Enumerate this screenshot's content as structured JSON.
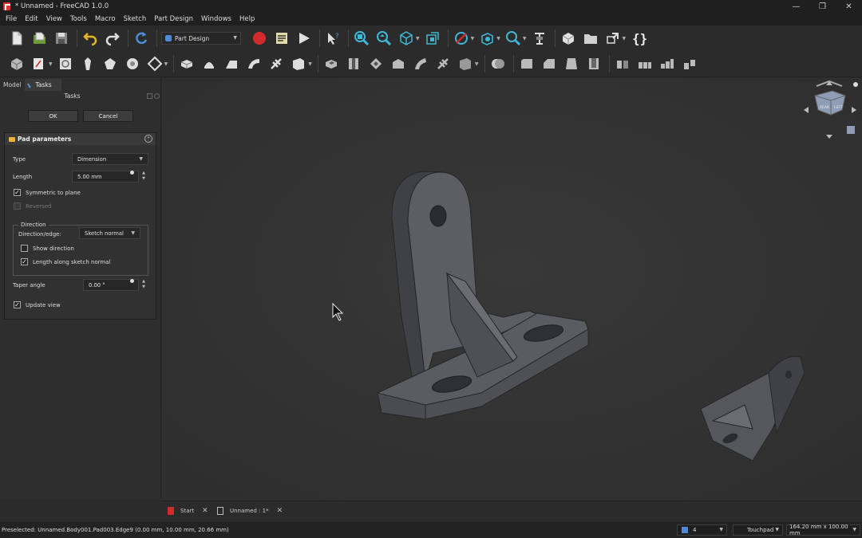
{
  "window": {
    "title": "* Unnamed - FreeCAD 1.0.0",
    "minimize": "—",
    "maximize": "❐",
    "close": "✕"
  },
  "menu": [
    "File",
    "Edit",
    "View",
    "Tools",
    "Macro",
    "Sketch",
    "Part Design",
    "Windows",
    "Help"
  ],
  "toolbar": {
    "workbench": "Part Design",
    "icons_row1": [
      "new-file-icon",
      "open-file-icon",
      "save-icon",
      "undo-icon",
      "redo-icon",
      "refresh-icon",
      "macro-record-icon",
      "macro-edit-icon",
      "macro-run-icon",
      "whats-this-icon",
      "fit-all-icon",
      "fit-selection-icon",
      "standard-views-icon",
      "sketch-view-icon",
      "draw-style-icon",
      "bounding-box-icon",
      "zoom-icon",
      "measure-icon",
      "part-icon",
      "group-icon",
      "link-icon",
      "python-braces-icon"
    ],
    "icons_row2": [
      "body-icon",
      "sketch-icon",
      "validate-sketch-icon",
      "clone-icon",
      "shape-binder-icon",
      "sub-shape-binder-icon",
      "datum-plane-icon",
      "pad-icon",
      "revolution-icon",
      "additive-loft-icon",
      "additive-pipe-icon",
      "additive-helix-icon",
      "additive-primitive-icon",
      "pocket-icon",
      "hole-icon",
      "groove-icon",
      "subtractive-loft-icon",
      "subtractive-pipe-icon",
      "subtractive-helix-icon",
      "subtractive-primitive-icon",
      "boolean-icon",
      "fillet-icon",
      "chamfer-icon",
      "draft-icon",
      "thickness-icon",
      "mirrored-icon",
      "linear-pattern-icon",
      "polar-pattern-icon",
      "multi-transform-icon"
    ]
  },
  "panel": {
    "tabs": [
      "Model",
      "Tasks"
    ],
    "title": "Tasks",
    "ok_label": "OK",
    "cancel_label": "Cancel",
    "pad": {
      "header": "Pad parameters",
      "type_label": "Type",
      "type_value": "Dimension",
      "length_label": "Length",
      "length_value": "5.00 mm",
      "symmetric_label": "Symmetric to plane",
      "symmetric_checked": true,
      "reversed_label": "Reversed",
      "reversed_checked": false,
      "direction_title": "Direction",
      "direction_edge_label": "Direction/edge:",
      "direction_edge_value": "Sketch normal",
      "show_direction_label": "Show direction",
      "show_direction_checked": false,
      "length_along_label": "Length along sketch normal",
      "length_along_checked": true,
      "taper_label": "Taper angle",
      "taper_value": "0.00 °",
      "update_view_label": "Update view",
      "update_view_checked": true
    }
  },
  "navcube": {
    "faces": [
      "REAR",
      "LEFT"
    ]
  },
  "doc_tabs": [
    {
      "label": "Start"
    },
    {
      "label": "Unnamed : 1*"
    }
  ],
  "status": {
    "message": "Preselected: Unnamed.Body001.Pad003.Edge9 (0.00 mm, 10.00 mm, 20.66 mm)",
    "layer_value": "4",
    "navigation": "Touchpad",
    "dimensions": "164.20 mm x 100.00 mm"
  },
  "colors": {
    "background": "#2b2b2b",
    "viewport": "#333333",
    "model_face": "#5b5d62",
    "accent_red": "#d22a2a",
    "pad_icon": "#e9b333"
  }
}
